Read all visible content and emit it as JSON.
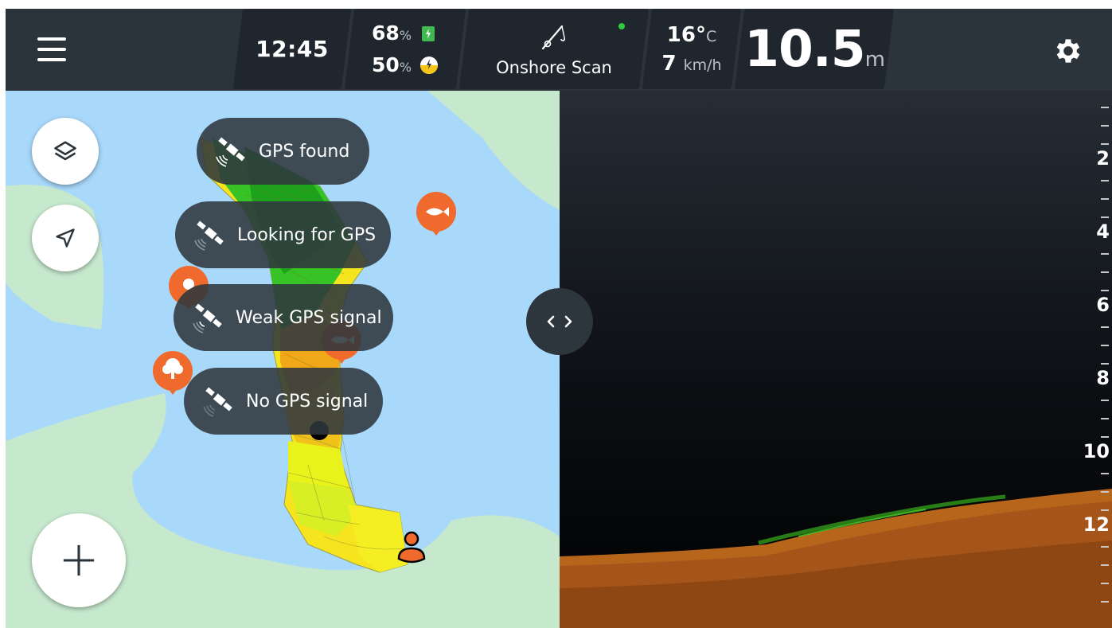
{
  "topbar": {
    "menu_icon": "hamburger-menu-icon",
    "time": "12:45",
    "battery_phone_pct": "68",
    "battery_phone_unit": "%",
    "battery_device_pct": "50",
    "battery_device_unit": "%",
    "mode_icon": "fishing-rod-icon",
    "mode_label": "Onshore Scan",
    "connection_status_color": "#2ecc40",
    "water_temp": "16°",
    "water_temp_unit": "C",
    "wind_speed": "7",
    "wind_speed_unit": "km/h",
    "depth": "10.5",
    "depth_unit": "m",
    "settings_icon": "gear-icon"
  },
  "gps_statuses": [
    {
      "label": "GPS found",
      "icon": "satellite-icon"
    },
    {
      "label": "Looking for GPS",
      "icon": "satellite-icon"
    },
    {
      "label": "Weak GPS signal",
      "icon": "satellite-icon"
    },
    {
      "label": "No GPS signal",
      "icon": "satellite-icon"
    }
  ],
  "map": {
    "layers_icon": "layers-icon",
    "navigation_icon": "navigation-arrow-icon",
    "add_icon": "plus-icon",
    "water_color": "#a8d8fa",
    "land_color": "#c6e8cd",
    "marker_color": "#ef6a2c"
  },
  "sonar": {
    "depth_scale": [
      "2",
      "4",
      "6",
      "8",
      "10",
      "12"
    ],
    "bottom_color": "#c06a1a",
    "vegetation_color": "#3fa41f"
  },
  "split_toggle": {
    "left_icon": "chevron-left-icon",
    "right_icon": "chevron-right-icon"
  }
}
